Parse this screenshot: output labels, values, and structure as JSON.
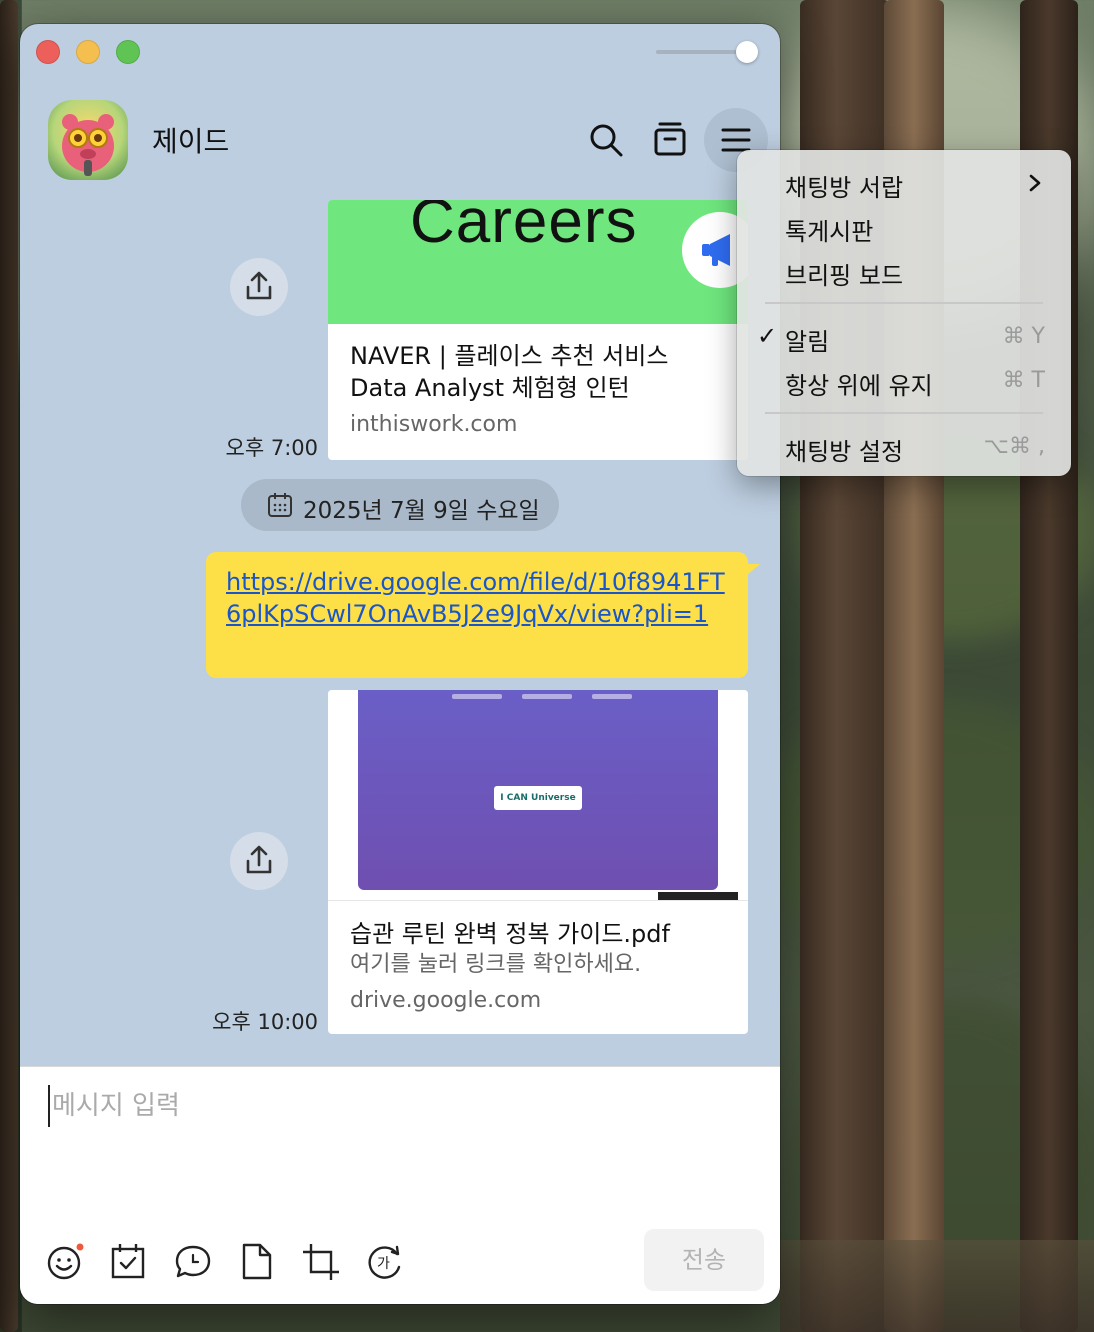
{
  "window": {
    "chat_title": "제이드"
  },
  "messages": {
    "card1": {
      "banner_text": "Careers",
      "title_line1": "NAVER | 플레이스 추천 서비스",
      "title_line2": "Data Analyst 체험형 인턴",
      "domain": "inthiswork.com",
      "time": "오후 7:00"
    },
    "date_divider": "2025년 7월 9일 수요일",
    "link_message": "https://drive.google.com/file/d/10f8941FT6plKpSCwl7OnAvB5J2e9JqVx/view?pli=1",
    "card2": {
      "preview_button": "I CAN Universe",
      "title": "습관 루틴 완벽 정복 가이드.pdf",
      "subtitle": "여기를 눌러 링크를 확인하세요.",
      "domain": "drive.google.com",
      "time": "오후 10:00"
    }
  },
  "composer": {
    "placeholder": "메시지 입력",
    "send_label": "전송",
    "tools": [
      "emoji-icon",
      "calendar-check-icon",
      "speech-bubble-icon",
      "file-icon",
      "crop-icon",
      "translate-icon"
    ]
  },
  "menu": {
    "items": [
      {
        "label": "채팅방 서랍",
        "shortcut": ""
      },
      {
        "label": "톡게시판",
        "shortcut": ""
      },
      {
        "label": "브리핑 보드",
        "shortcut": ""
      },
      {
        "label": "알림",
        "shortcut": "⌘ Y",
        "checked": true
      },
      {
        "label": "항상 위에 유지",
        "shortcut": "⌘ T"
      },
      {
        "label": "채팅방 설정",
        "shortcut": "⌥⌘ ,"
      }
    ]
  },
  "colors": {
    "chat_bg": "#bdcee0",
    "my_bubble": "#fde047",
    "link": "#1a56c9",
    "card_green": "#6fe67e",
    "preview_purple": "#6a5fc7"
  }
}
